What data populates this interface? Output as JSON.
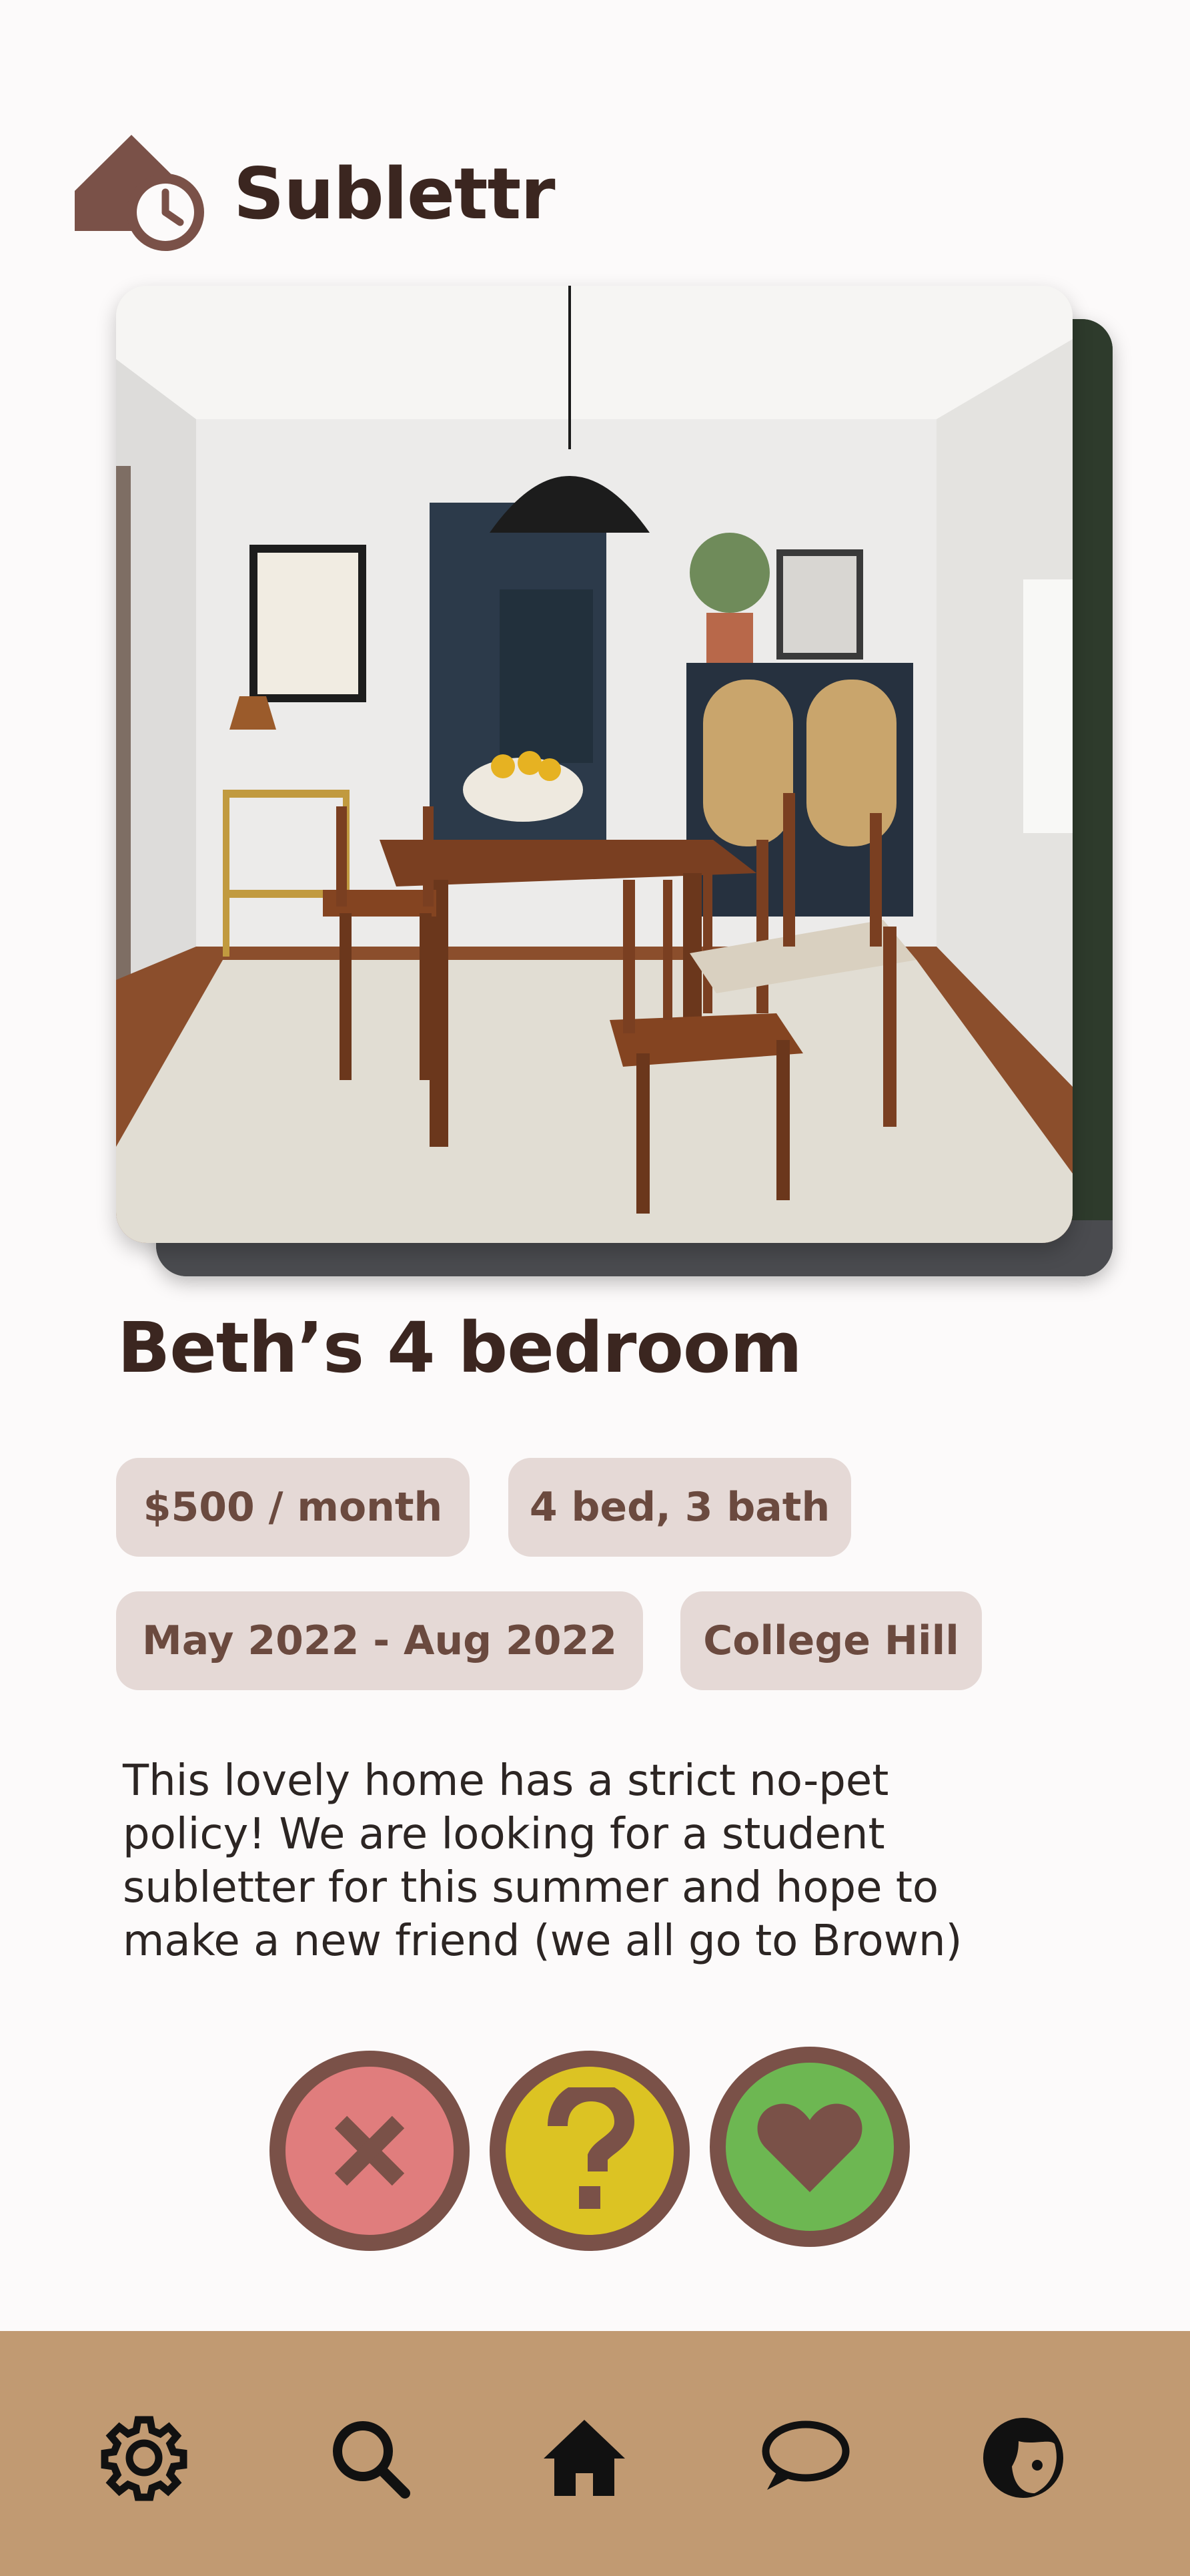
{
  "app": {
    "name": "Sublettr",
    "logo_icon": "house-clock-icon"
  },
  "listing": {
    "title": "Beth’s 4 bedroom",
    "photo": "dining-room-photo",
    "price": "$500 / month",
    "beds_baths": "4 bed, 3 bath",
    "dates": "May 2022 - Aug 2022",
    "neighborhood": "College Hill",
    "description": "This lovely home has a strict no-pet policy! We are looking for a student subletter for this summer and hope to make a new friend (we all go to Brown)"
  },
  "actions": [
    {
      "name": "reject",
      "icon": "close-icon",
      "color": "#e07d7d"
    },
    {
      "name": "question",
      "icon": "question-mark-icon",
      "color": "#dcc323"
    },
    {
      "name": "like",
      "icon": "heart-icon",
      "color": "#6db752"
    }
  ],
  "nav": {
    "items": [
      {
        "name": "settings",
        "icon": "gear-icon"
      },
      {
        "name": "search",
        "icon": "search-icon"
      },
      {
        "name": "home",
        "icon": "home-icon"
      },
      {
        "name": "messages",
        "icon": "chat-bubble-icon"
      },
      {
        "name": "profile",
        "icon": "profile-icon"
      }
    ],
    "background": "#c19a72"
  },
  "colors": {
    "brand_brown": "#7a5148",
    "text_dark": "#3b2620",
    "chip_bg": "#e5d9d6",
    "chip_text": "#6b4a3f"
  }
}
